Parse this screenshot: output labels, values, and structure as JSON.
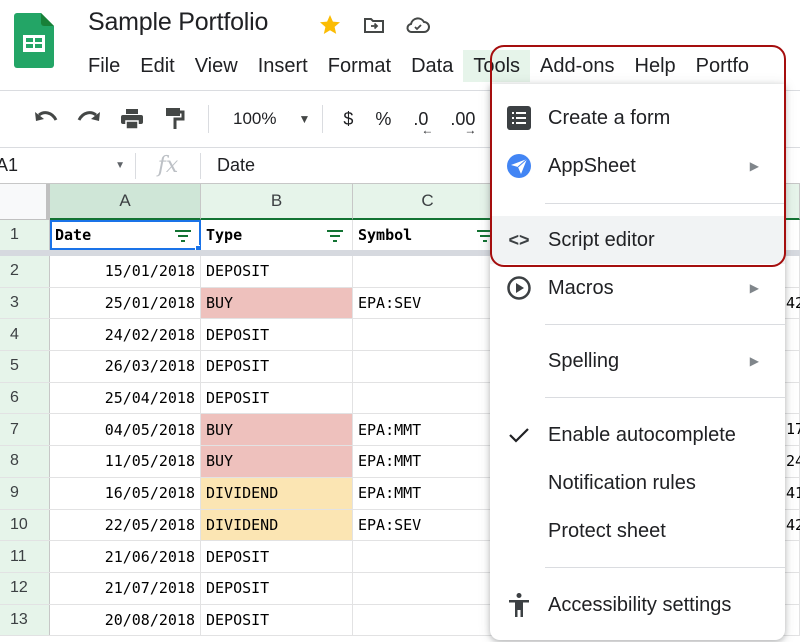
{
  "app": {
    "doc_title": "Sample Portfolio",
    "title_icons": [
      "star-icon",
      "move-to-folder-icon",
      "cloud-saved-icon"
    ],
    "colors": {
      "brand": "#0f9d58",
      "accent": "#1a73e8",
      "star": "#fbbc04",
      "highlight": "#a50e0e"
    }
  },
  "menubar": {
    "items": [
      {
        "label": "File"
      },
      {
        "label": "Edit"
      },
      {
        "label": "View"
      },
      {
        "label": "Insert"
      },
      {
        "label": "Format"
      },
      {
        "label": "Data"
      },
      {
        "label": "Tools",
        "active": true
      },
      {
        "label": "Add-ons"
      },
      {
        "label": "Help"
      },
      {
        "label": "Portfo"
      }
    ]
  },
  "toolbar": {
    "undo": "undo-icon",
    "redo": "redo-icon",
    "print": "print-icon",
    "paint_format": "paint-format-icon",
    "zoom": "100%",
    "currency": "$",
    "percent": "%",
    "decrease_decimal": ".0",
    "increase_decimal": ".00"
  },
  "formula_bar": {
    "cell_ref": "A1",
    "fx": "fx",
    "value": "Date"
  },
  "grid": {
    "columns": [
      "A",
      "B",
      "C"
    ],
    "headers": [
      "Date",
      "Type",
      "Symbol"
    ],
    "rows": [
      {
        "n": "2",
        "date": "15/01/2018",
        "type": "DEPOSIT",
        "symbol": "",
        "style": ""
      },
      {
        "n": "3",
        "date": "25/01/2018",
        "type": "BUY",
        "symbol": "EPA:SEV",
        "style": "buy"
      },
      {
        "n": "4",
        "date": "24/02/2018",
        "type": "DEPOSIT",
        "symbol": "",
        "style": ""
      },
      {
        "n": "5",
        "date": "26/03/2018",
        "type": "DEPOSIT",
        "symbol": "",
        "style": ""
      },
      {
        "n": "6",
        "date": "25/04/2018",
        "type": "DEPOSIT",
        "symbol": "",
        "style": ""
      },
      {
        "n": "7",
        "date": "04/05/2018",
        "type": "BUY",
        "symbol": "EPA:MMT",
        "style": "buy"
      },
      {
        "n": "8",
        "date": "11/05/2018",
        "type": "BUY",
        "symbol": "EPA:MMT",
        "style": "buy"
      },
      {
        "n": "9",
        "date": "16/05/2018",
        "type": "DIVIDEND",
        "symbol": "EPA:MMT",
        "style": "div"
      },
      {
        "n": "10",
        "date": "22/05/2018",
        "type": "DIVIDEND",
        "symbol": "EPA:SEV",
        "style": "div"
      },
      {
        "n": "11",
        "date": "21/06/2018",
        "type": "DEPOSIT",
        "symbol": "",
        "style": ""
      },
      {
        "n": "12",
        "date": "21/07/2018",
        "type": "DEPOSIT",
        "symbol": "",
        "style": ""
      },
      {
        "n": "13",
        "date": "20/08/2018",
        "type": "DEPOSIT",
        "symbol": "",
        "style": ""
      }
    ],
    "partial_right_values": [
      {
        "row": "3",
        "text": "42"
      },
      {
        "row": "7",
        "text": "17"
      },
      {
        "row": "8",
        "text": "24"
      },
      {
        "row": "9",
        "text": "41"
      },
      {
        "row": "10",
        "text": "42"
      }
    ]
  },
  "tools_menu": {
    "items": [
      {
        "label": "Create a form",
        "icon": "form-icon"
      },
      {
        "label": "AppSheet",
        "icon": "appsheet-icon",
        "submenu": true
      },
      {
        "label": "Script editor",
        "icon": "code-icon",
        "hovered": true
      },
      {
        "label": "Macros",
        "icon": "play-circle-icon",
        "submenu": true
      },
      {
        "label": "Spelling",
        "icon": "",
        "submenu": true
      },
      {
        "label": "Enable autocomplete",
        "icon": "check-icon",
        "checked": true
      },
      {
        "label": "Notification rules",
        "icon": ""
      },
      {
        "label": "Protect sheet",
        "icon": ""
      },
      {
        "label": "Accessibility settings",
        "icon": "accessibility-icon"
      }
    ],
    "submenu_glyph": "▶"
  }
}
